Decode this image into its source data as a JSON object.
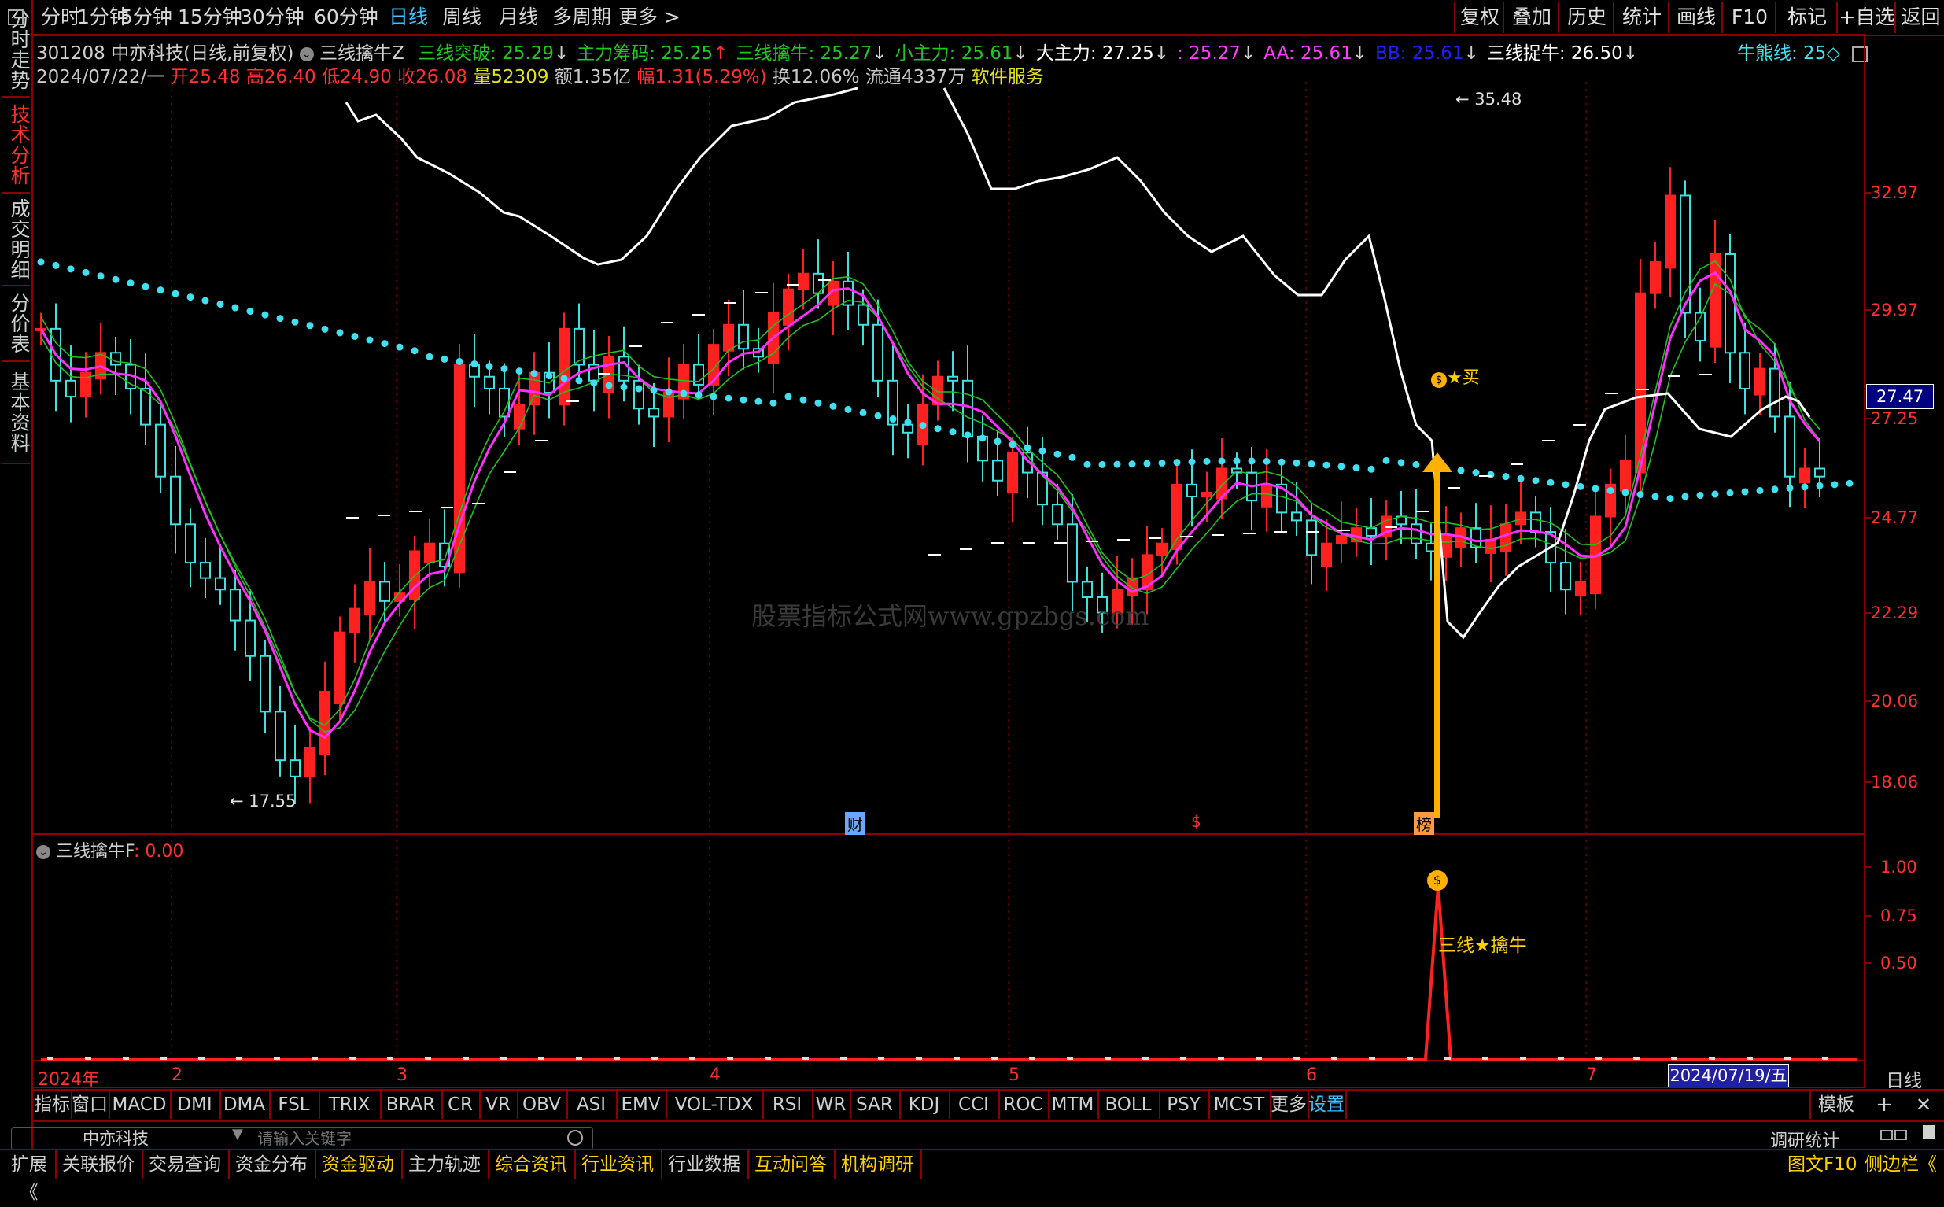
{
  "period_tabs": [
    "分时",
    "1分钟",
    "5分钟",
    "15分钟",
    "30分钟",
    "60分钟",
    "日线",
    "周线",
    "月线",
    "多周期",
    "更多 >"
  ],
  "active_period": "日线",
  "right_buttons": [
    "复权",
    "叠加",
    "历史",
    "统计",
    "画线",
    "F10",
    "标记",
    "+自选",
    "返回"
  ],
  "sidebar": [
    "分时走势",
    "技术分析",
    "成交明细",
    "分价表",
    "基本资料"
  ],
  "stock": {
    "code": "301208",
    "name": "中亦科技",
    "mode": "(日线,前复权)",
    "formula": "三线擒牛Z"
  },
  "indicators": [
    {
      "label": "三线突破: 25.29",
      "arrow": "↓",
      "color": "#1ec81e"
    },
    {
      "label": "主力筹码: 25.25",
      "arrow": "↑",
      "color": "#1ec81e"
    },
    {
      "label": "三线擒牛: 25.27",
      "arrow": "↓",
      "color": "#1ec81e"
    },
    {
      "label": "小主力: 25.61",
      "arrow": "↓",
      "color": "#1ec81e"
    },
    {
      "label": "大主力: 27.25",
      "arrow": "↓",
      "color": "#ffffff"
    },
    {
      "label": ": 25.27",
      "arrow": "↓",
      "color": "#ff3cff"
    },
    {
      "label": "AA: 25.61",
      "arrow": "↓",
      "color": "#ff3cff"
    },
    {
      "label": "BB: 25.61",
      "arrow": "↓",
      "color": "#2020ff"
    },
    {
      "label": "三线捉牛: 26.50",
      "arrow": "↓",
      "color": "#ffffff"
    }
  ],
  "niu_label": "牛熊线: 25",
  "quote": {
    "date": "2024/07/22/一",
    "open": "开25.48",
    "high": "高26.40",
    "low": "低24.90",
    "close": "收26.08",
    "vol": "量52309",
    "amount": "额1.35亿",
    "change": "幅1.31(5.29%)",
    "turnover": "换12.06%",
    "float": "流通4337万",
    "industry": "软件服务"
  },
  "price_axis": [
    "32.97",
    "29.97",
    "27.25",
    "24.77",
    "22.29",
    "20.06",
    "18.06"
  ],
  "current_price": "27.47",
  "high_mark": "35.48",
  "low_mark": "17.55",
  "buy_label": "买",
  "watermark": "股票指标公式网www.gpzbgs.com",
  "event_markers": [
    "财",
    "$",
    "榜"
  ],
  "sub_panel": {
    "title": "三线擒牛F",
    "value": ": 0.00",
    "axis": [
      "1.00",
      "0.75",
      "0.50"
    ],
    "signal_label": "三线★擒牛"
  },
  "date_axis": {
    "year": "2024年",
    "months": [
      "2",
      "3",
      "4",
      "5",
      "6",
      "7"
    ],
    "cursor_date": "2024/07/19/五",
    "right_label": "日线"
  },
  "indicator_tabs": [
    "指标",
    "窗口",
    "MACD",
    "DMI",
    "DMA",
    "FSL",
    "TRIX",
    "BRAR",
    "CR",
    "VR",
    "OBV",
    "ASI",
    "EMV",
    "VOL-TDX",
    "RSI",
    "WR",
    "SAR",
    "KDJ",
    "CCI",
    "ROC",
    "MTM",
    "BOLL",
    "PSY",
    "MCST",
    "更多",
    "设置"
  ],
  "template_label": "模板",
  "search": {
    "stock": "中亦科技",
    "placeholder": "请输入关键字",
    "right": "调研统计"
  },
  "bottom_tabs": [
    "扩展",
    "关联报价",
    "交易查询",
    "资金分布",
    "资金驱动",
    "主力轨迹",
    "综合资讯",
    "行业资讯",
    "行业数据",
    "互动问答",
    "机构调研"
  ],
  "bottom_right": [
    "图文F10",
    "侧边栏"
  ],
  "colors": {
    "up": "#ff2020",
    "down": "#40e0e0",
    "dots": "#40e0f0",
    "magenta": "#ff30ff",
    "green": "#20c020",
    "white": "#ffffff",
    "arrow": "#ffb000",
    "frame": "#8b0000"
  }
}
